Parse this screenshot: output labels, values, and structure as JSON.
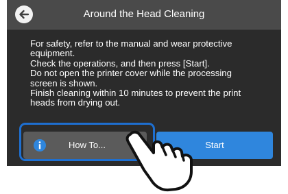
{
  "header": {
    "title": "Around the Head Cleaning"
  },
  "instructions": [
    "For safety, refer to the manual and wear protective equipment.",
    "Check the operations, and then press [Start].",
    "Do not open the printer cover while the processing screen is shown.",
    "Finish cleaning within 10 minutes to prevent the print heads from drying out."
  ],
  "buttons": {
    "howto_label": "How To...",
    "start_label": "Start"
  },
  "colors": {
    "accent": "#2f86dd",
    "focus": "#1e6fd0",
    "panel": "#2b2b2b",
    "header": "#4a4a4a"
  },
  "icons": {
    "back": "back-arrow-icon",
    "info": "info-icon",
    "pointer": "pointing-hand-icon"
  }
}
